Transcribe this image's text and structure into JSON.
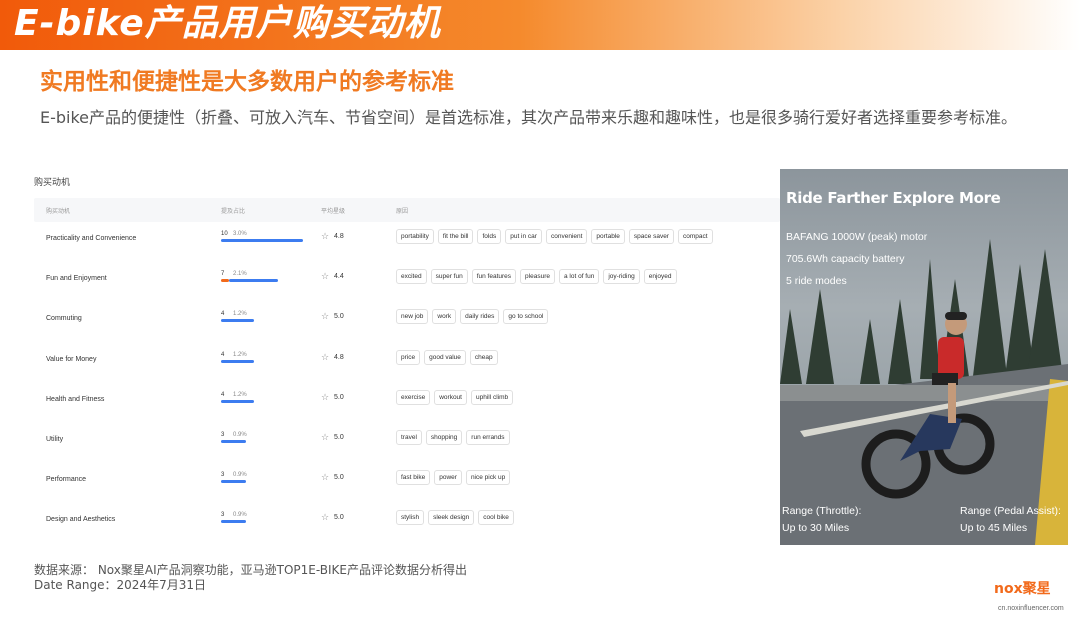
{
  "header": {
    "title": "E-bike产品用户购买动机",
    "subtitle": "实用性和便捷性是大多数用户的参考标准",
    "description": "E-bike产品的便捷性（折叠、可放入汽车、节省空间）是首选标准，其次产品带来乐趣和趣味性，也是很多骑行爱好者选择重要参考标准。"
  },
  "panel": {
    "title": "购买动机",
    "columns": [
      "购买动机",
      "提及占比",
      "平均星级",
      "原因"
    ],
    "rows": [
      {
        "name": "Practicality and Convenience",
        "count": "10",
        "pct": "3.0%",
        "share": 3.0,
        "rating": "4.8",
        "tags": [
          "portability",
          "fit the bill",
          "folds",
          "put in car",
          "convenient",
          "portable",
          "space saver",
          "compact"
        ]
      },
      {
        "name": "Fun and Enjoyment",
        "count": "7",
        "pct": "2.1%",
        "share": 2.1,
        "rating": "4.4",
        "tags": [
          "excited",
          "super fun",
          "fun features",
          "pleasure",
          "a lot of fun",
          "joy-riding",
          "enjoyed"
        ]
      },
      {
        "name": "Commuting",
        "count": "4",
        "pct": "1.2%",
        "share": 1.2,
        "rating": "5.0",
        "tags": [
          "new job",
          "work",
          "daily rides",
          "go to school"
        ]
      },
      {
        "name": "Value for Money",
        "count": "4",
        "pct": "1.2%",
        "share": 1.2,
        "rating": "4.8",
        "tags": [
          "price",
          "good value",
          "cheap"
        ]
      },
      {
        "name": "Health and Fitness",
        "count": "4",
        "pct": "1.2%",
        "share": 1.2,
        "rating": "5.0",
        "tags": [
          "exercise",
          "workout",
          "uphill climb"
        ]
      },
      {
        "name": "Utility",
        "count": "3",
        "pct": "0.9%",
        "share": 0.9,
        "rating": "5.0",
        "tags": [
          "travel",
          "shopping",
          "run errands"
        ]
      },
      {
        "name": "Performance",
        "count": "3",
        "pct": "0.9%",
        "share": 0.9,
        "rating": "5.0",
        "tags": [
          "fast bike",
          "power",
          "nice pick up"
        ]
      },
      {
        "name": "Design and Aesthetics",
        "count": "3",
        "pct": "0.9%",
        "share": 0.9,
        "rating": "5.0",
        "tags": [
          "stylish",
          "sleek design",
          "cool bike"
        ]
      }
    ]
  },
  "promo": {
    "headline": "Ride Farther Explore More",
    "specs": [
      "BAFANG 1000W (peak) motor",
      "705.6Wh capacity battery",
      "5 ride modes"
    ],
    "range_throttle_label": "Range (Throttle):",
    "range_throttle_value": "Up to 30 Miles",
    "range_pedal_label": "Range (Pedal Assist):",
    "range_pedal_value": "Up to 45 Miles"
  },
  "footer": {
    "source": "数据来源： Nox聚星AI产品洞察功能，亚马逊TOP1E-BIKE产品评论数据分析得出",
    "date_range": "Date Range：2024年7月31日",
    "logo": "nox聚星",
    "logo_url": "cn.noxinfluencer.com"
  },
  "colors": {
    "accent": "#f26a1b",
    "bar": "#3c7cf0",
    "subtitle": "#f07a22"
  }
}
